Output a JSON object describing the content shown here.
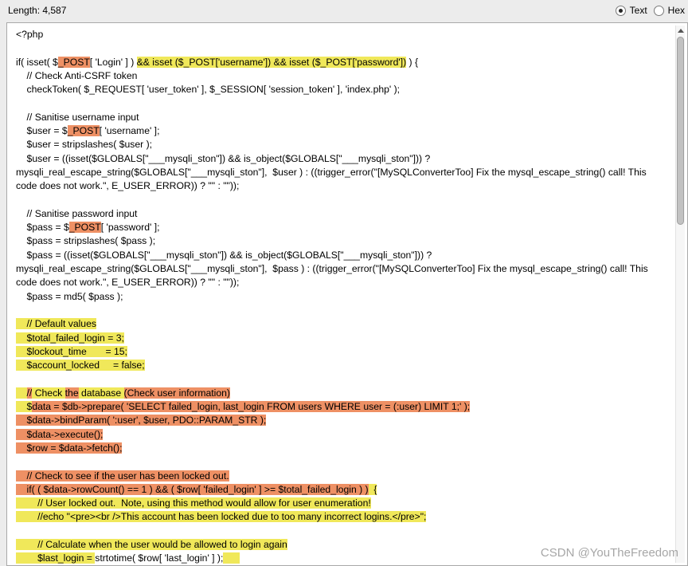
{
  "toolbar": {
    "length_label": "Length: 4,587",
    "mode_options": [
      {
        "label": "Text",
        "selected": true
      },
      {
        "label": "Hex",
        "selected": false
      }
    ]
  },
  "highlight_colors": {
    "yellow": "#f0e85a",
    "orange": "#ee9064"
  },
  "code_lines": [
    [
      [
        "",
        "<?php"
      ]
    ],
    [],
    [
      [
        "",
        "if( isset( $"
      ],
      [
        "o",
        "_POST"
      ],
      [
        "",
        "[ 'Login' ] ) "
      ],
      [
        "y",
        "&& isset ($_POST['username']) && isset ($_POST['password'])"
      ],
      [
        "",
        " ) {"
      ]
    ],
    [
      [
        "",
        "    // Check Anti-CSRF token"
      ]
    ],
    [
      [
        "",
        "    checkToken( $_REQUEST[ 'user_token' ], $_SESSION[ 'session_token' ], 'index.php' );"
      ]
    ],
    [],
    [
      [
        "",
        "    // Sanitise username input"
      ]
    ],
    [
      [
        "",
        "    $user = $"
      ],
      [
        "o",
        "_POST"
      ],
      [
        "",
        "[ 'username' ];"
      ]
    ],
    [
      [
        "",
        "    $user = stripslashes( $user );"
      ]
    ],
    [
      [
        "",
        "    $user = ((isset($GLOBALS[\"___mysqli_ston\"]) && is_object($GLOBALS[\"___mysqli_ston\"])) ? mysqli_real_escape_string($GLOBALS[\"___mysqli_ston\"],  $user ) : ((trigger_error(\"[MySQLConverterToo] Fix the mysql_escape_string() call! This code does not work.\", E_USER_ERROR)) ? \"\" : \"\"));"
      ]
    ],
    [],
    [
      [
        "",
        "    // Sanitise password input"
      ]
    ],
    [
      [
        "",
        "    $pass = $"
      ],
      [
        "o",
        "_POST"
      ],
      [
        "",
        "[ 'password' ];"
      ]
    ],
    [
      [
        "",
        "    $pass = stripslashes( $pass );"
      ]
    ],
    [
      [
        "",
        "    $pass = ((isset($GLOBALS[\"___mysqli_ston\"]) && is_object($GLOBALS[\"___mysqli_ston\"])) ? mysqli_real_escape_string($GLOBALS[\"___mysqli_ston\"],  $pass ) : ((trigger_error(\"[MySQLConverterToo] Fix the mysql_escape_string() call! This code does not work.\", E_USER_ERROR)) ? \"\" : \"\"));"
      ]
    ],
    [
      [
        "",
        "    $pass = md5( $pass );"
      ]
    ],
    [],
    [
      [
        "y",
        "    // "
      ],
      [
        "y",
        "Default values"
      ]
    ],
    [
      [
        "y",
        "    $total_failed_login = 3;"
      ]
    ],
    [
      [
        "y",
        "    $lockout_time       = 15;"
      ]
    ],
    [
      [
        "y",
        "    $account_locked     = false;"
      ]
    ],
    [],
    [
      [
        "y",
        "    "
      ],
      [
        "o",
        "//"
      ],
      [
        "y",
        " Check "
      ],
      [
        "o",
        "the"
      ],
      [
        "y",
        " database "
      ],
      [
        "o",
        "(Check user information)"
      ]
    ],
    [
      [
        "y",
        "    $"
      ],
      [
        "o",
        "data = $db->prepare( 'SELECT failed_login, last_login FROM users WHERE user = (:user) LIMIT 1;' );"
      ]
    ],
    [
      [
        "o",
        "    $data->bindParam( ':user', $user, PDO::PARAM_STR );"
      ]
    ],
    [
      [
        "o",
        "    $data->execute();"
      ]
    ],
    [
      [
        "o",
        "    $row = $data->fetch();"
      ]
    ],
    [],
    [
      [
        "o",
        "    // Check to see if the user has been locked out."
      ]
    ],
    [
      [
        "o",
        "    if( ( $data->rowCount() == 1 ) && ( $row[ 'failed_login' ] >= $total_failed_login ) )"
      ],
      [
        "y",
        "  {"
      ]
    ],
    [
      [
        "y",
        "        // User locked out.  Note, using this method would allow for user enumeration!"
      ]
    ],
    [
      [
        "y",
        "        //echo \"<pre><br />This account has been locked due to too many incorrect logins.</pre>\";"
      ]
    ],
    [],
    [
      [
        "y",
        "        // Calculate when the user would be allowed to login again"
      ]
    ],
    [
      [
        "y",
        "        $last_login = "
      ],
      [
        "",
        "strtotime( $row[ 'last_login' ] );"
      ],
      [
        "y",
        "      "
      ]
    ]
  ],
  "watermark": "CSDN @YouTheFreedom"
}
